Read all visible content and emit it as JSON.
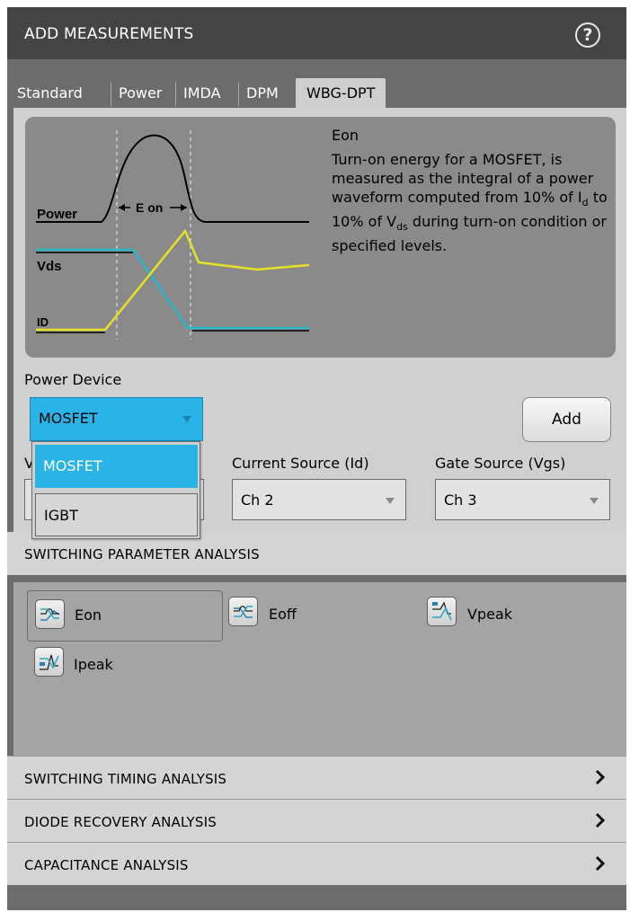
{
  "header": {
    "title": "ADD MEASUREMENTS",
    "help_icon": "question-circle-icon",
    "help_label": "?"
  },
  "tabs": [
    {
      "label": "Standard",
      "active": false
    },
    {
      "label": "Power",
      "active": false
    },
    {
      "label": "IMDA",
      "active": false
    },
    {
      "label": "DPM",
      "active": false
    },
    {
      "label": "WBG-DPT",
      "active": true
    }
  ],
  "info": {
    "title": "Eon",
    "description": "Turn-on energy for a MOSFET, is measured as the integral of a power waveform computed from 10% of I",
    "desc_sub_d": "d",
    "desc_mid": " to 10% of V",
    "desc_sub_ds": "ds",
    "desc_end": " during turn-on condition or specified levels.",
    "diagram": {
      "power_label": "Power",
      "vds_label": "Vds",
      "id_label": "ID",
      "eon_label": "E on",
      "colors": {
        "power": "#000000",
        "vds": "#e8e024",
        "id": "#27b7c9"
      }
    }
  },
  "power_device": {
    "label": "Power Device",
    "value": "MOSFET",
    "options": [
      "MOSFET",
      "IGBT"
    ]
  },
  "add_button": "Add",
  "sources": {
    "voltage_label_partial": "V",
    "current_label": "Current Source (Id)",
    "current_value": "Ch 2",
    "gate_label": "Gate Source (Vgs)",
    "gate_value": "Ch 3"
  },
  "sections": {
    "switching_parameter": "SWITCHING PARAMETER ANALYSIS",
    "switching_timing": "SWITCHING TIMING ANALYSIS",
    "diode_recovery": "DIODE RECOVERY ANALYSIS",
    "capacitance": "CAPACITANCE ANALYSIS"
  },
  "measurements": [
    {
      "label": "Eon",
      "icon": "eon-waveform-icon",
      "selected": true
    },
    {
      "label": "Eoff",
      "icon": "eoff-waveform-icon",
      "selected": false
    },
    {
      "label": "Vpeak",
      "icon": "vpeak-waveform-icon",
      "selected": false
    },
    {
      "label": "Ipeak",
      "icon": "ipeak-waveform-icon",
      "selected": false
    }
  ],
  "colors": {
    "accent": "#29b3e6",
    "header_bg": "#444444"
  }
}
